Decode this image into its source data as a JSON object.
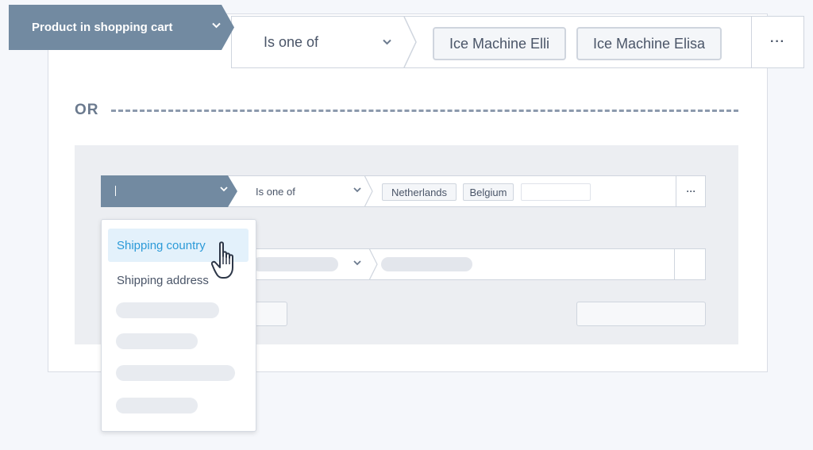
{
  "top_rule": {
    "attribute": "Product in shopping cart",
    "operator": "Is one of",
    "values": [
      "Ice Machine Elli",
      "Ice Machine Elisa"
    ],
    "more": "···"
  },
  "or_label": "OR",
  "group_rule": {
    "attribute": "",
    "operator": "Is one of",
    "values": [
      "Netherlands",
      "Belgium"
    ],
    "more": "···"
  },
  "dropdown": {
    "items": [
      "Shipping country",
      "Shipping address"
    ],
    "active_index": 0
  },
  "colors": {
    "attribute_bg": "#728aa1",
    "active_item_bg": "#e3f1fb",
    "active_item_text": "#2b9ad8",
    "group_bg": "#eceef2"
  },
  "icons": {
    "chevron": "chevron-down-icon",
    "cursor": "hand-pointer-icon"
  }
}
